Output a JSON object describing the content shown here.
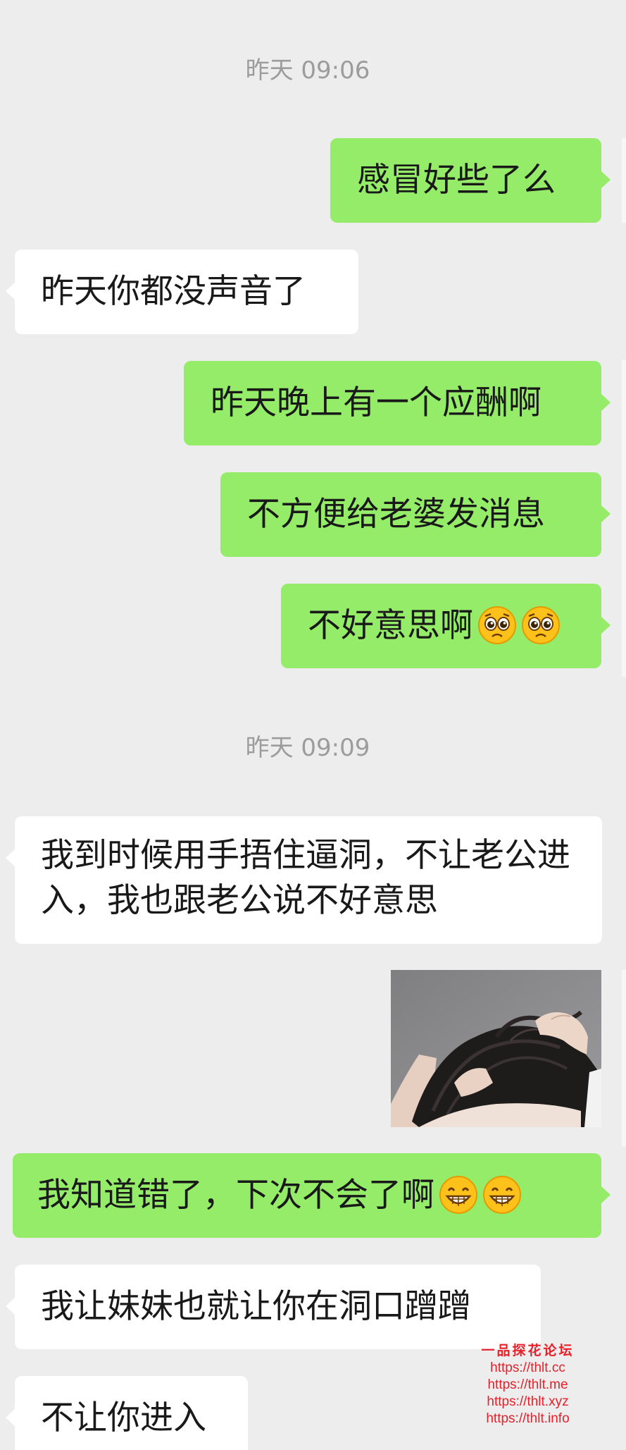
{
  "chat": {
    "timestamps": [
      "昨天 09:06",
      "昨天 09:09"
    ],
    "messages": [
      {
        "side": "out",
        "text": "感冒好些了么"
      },
      {
        "side": "in",
        "text": "昨天你都没声音了"
      },
      {
        "side": "out",
        "text": "昨天晚上有一个应酬啊"
      },
      {
        "side": "out",
        "text": "不方便给老婆发消息"
      },
      {
        "side": "out",
        "text": "不好意思啊",
        "emojis": [
          "pleading-face-emoji",
          "pleading-face-emoji"
        ]
      },
      {
        "side": "in",
        "text": "我到时候用手捂住逼洞，不让老公进入，我也跟老公说不好意思"
      },
      {
        "side": "out",
        "type": "image",
        "image": "scratching-head-photo"
      },
      {
        "side": "out",
        "text": "我知道错了，下次不会了啊",
        "emojis": [
          "grinning-face-emoji",
          "grinning-face-emoji"
        ]
      },
      {
        "side": "in",
        "text": "我让妹妹也就让你在洞口蹭蹭"
      },
      {
        "side": "in",
        "text": "不让你进入"
      }
    ]
  },
  "watermark": {
    "title": "一品探花论坛",
    "urls": [
      "https://thlt.cc",
      "https://thlt.me",
      "https://thlt.xyz",
      "https://thlt.info"
    ],
    "color": "#e8202a"
  },
  "colors": {
    "background": "#ededed",
    "outgoing_bubble": "#95ec69",
    "incoming_bubble": "#ffffff",
    "timestamp": "#9c9c9c"
  }
}
